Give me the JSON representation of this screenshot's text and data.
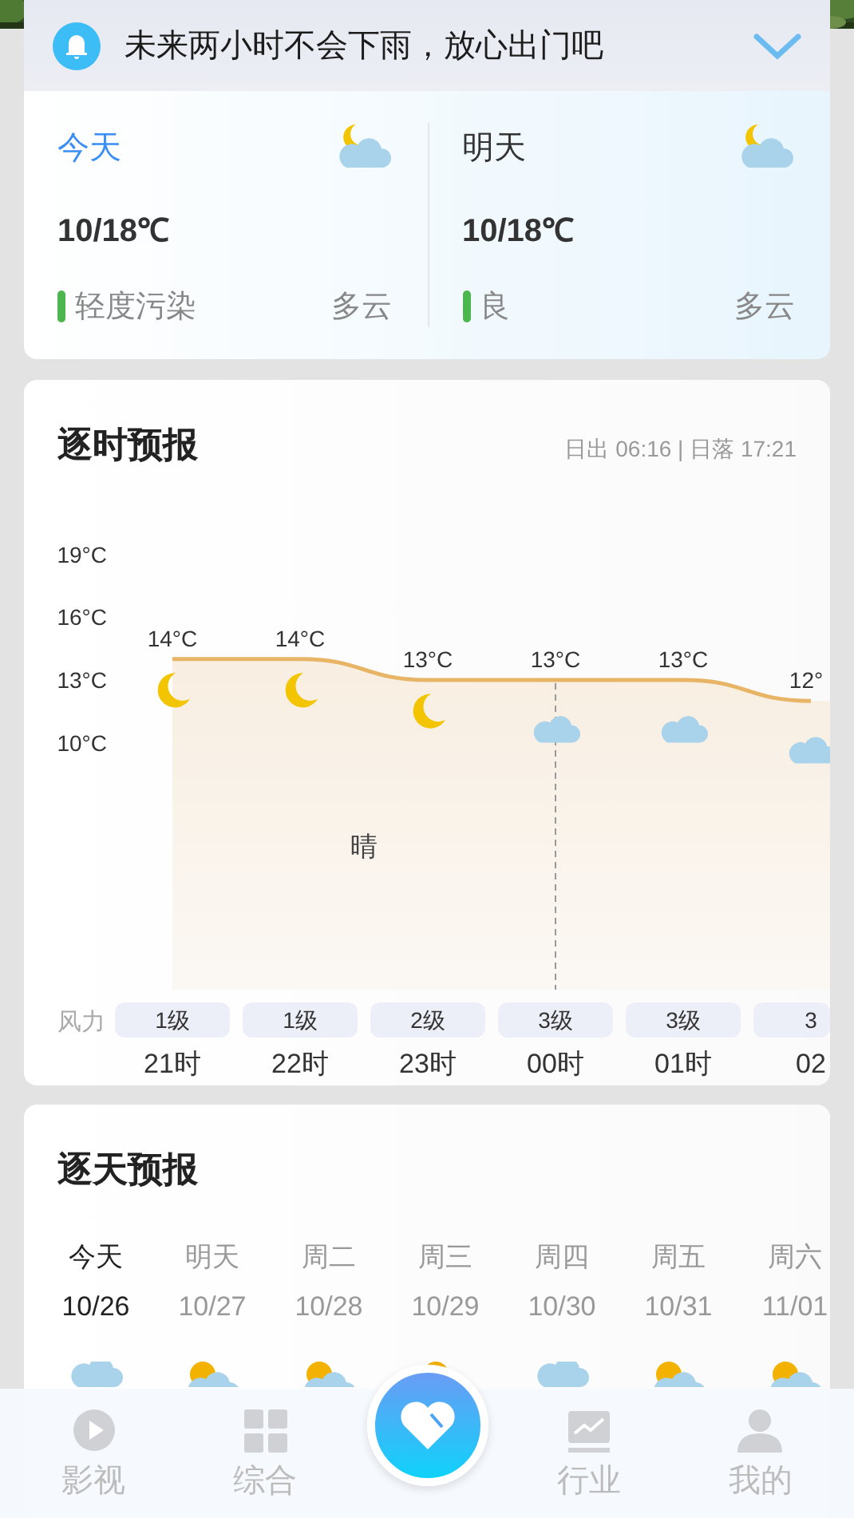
{
  "alert": {
    "text": "未来两小时不会下雨，放心出门吧"
  },
  "summary": [
    {
      "label": "今天",
      "selected": true,
      "temp": "10/18℃",
      "aqi": "轻度污染",
      "color": "#4cb64f",
      "condition": "多云",
      "kind": "moon_cloud"
    },
    {
      "label": "明天",
      "selected": false,
      "temp": "10/18℃",
      "aqi": "良",
      "color": "#4cb64f",
      "condition": "多云",
      "kind": "moon_cloud"
    }
  ],
  "hourly": {
    "title": "逐时预报",
    "sun": "日出 06:16 | 日落 17:21",
    "wind_label": "风力",
    "condition_label": "晴",
    "chart_data": {
      "type": "line",
      "categories": [
        "21时",
        "22时",
        "23时",
        "00时",
        "01时",
        "02"
      ],
      "values": [
        14,
        14,
        13,
        13,
        13,
        12
      ],
      "value_labels": [
        "14°C",
        "14°C",
        "13°C",
        "13°C",
        "13°C",
        "12°"
      ]
    },
    "axis_labels": [
      "19°C",
      "16°C",
      "13°C",
      "10°C"
    ],
    "hours": [
      {
        "wind": "1级",
        "kind": "moon"
      },
      {
        "wind": "1级",
        "kind": "moon"
      },
      {
        "wind": "2级",
        "kind": "moon"
      },
      {
        "wind": "3级",
        "kind": "cloud"
      },
      {
        "wind": "3级",
        "kind": "cloud"
      },
      {
        "wind": "3",
        "kind": "cloud"
      }
    ]
  },
  "daily": {
    "title": "逐天预报",
    "days": [
      {
        "day": "今天",
        "date": "10/26",
        "selected": true,
        "kind": "cloud"
      },
      {
        "day": "明天",
        "date": "10/27",
        "selected": false,
        "kind": "sun_cloud"
      },
      {
        "day": "周二",
        "date": "10/28",
        "selected": false,
        "kind": "sun_cloud"
      },
      {
        "day": "周三",
        "date": "10/29",
        "selected": false,
        "kind": "sun_cloud"
      },
      {
        "day": "周四",
        "date": "10/30",
        "selected": false,
        "kind": "cloud"
      },
      {
        "day": "周五",
        "date": "10/31",
        "selected": false,
        "kind": "sun_cloud"
      },
      {
        "day": "周六",
        "date": "11/01",
        "selected": false,
        "kind": "sun_cloud"
      }
    ]
  },
  "nav": {
    "items": [
      {
        "kind": "tab",
        "label": "影视"
      },
      {
        "kind": "tab",
        "label": "综合"
      },
      {
        "kind": "action"
      },
      {
        "kind": "tab",
        "label": "行业"
      },
      {
        "kind": "tab",
        "label": "我的"
      }
    ]
  }
}
